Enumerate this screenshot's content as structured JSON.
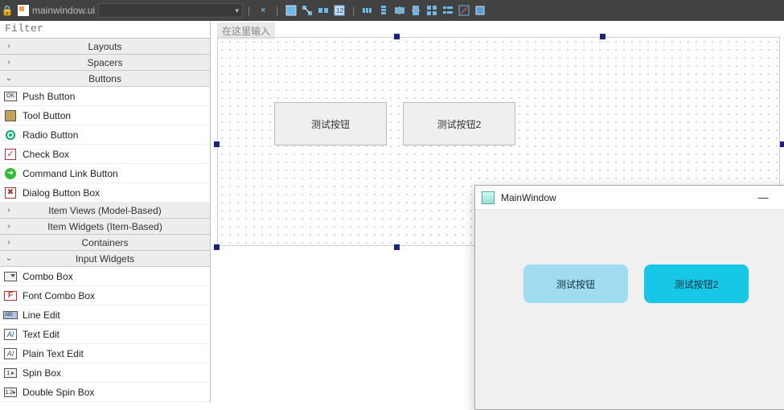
{
  "toolbar": {
    "filename": "mainwindow.ui",
    "close_glyph": "×",
    "icons": [
      "edit-widgets",
      "edit-signals",
      "edit-buddies",
      "edit-tabs",
      "lay-h",
      "lay-v",
      "lay-hs",
      "lay-vs",
      "lay-grid",
      "lay-form",
      "break-layout",
      "adjust-size"
    ]
  },
  "filter_placeholder": "Filter",
  "categories": {
    "layouts": {
      "label": "Layouts",
      "open": false,
      "arrow": "›"
    },
    "spacers": {
      "label": "Spacers",
      "open": false,
      "arrow": "›"
    },
    "buttons": {
      "label": "Buttons",
      "open": true,
      "arrow": "⌄"
    },
    "itemviews": {
      "label": "Item Views (Model-Based)",
      "open": false,
      "arrow": "›"
    },
    "itemwidgets": {
      "label": "Item Widgets (Item-Based)",
      "open": false,
      "arrow": "›"
    },
    "containers": {
      "label": "Containers",
      "open": false,
      "arrow": "›"
    },
    "inputwidgets": {
      "label": "Input Widgets",
      "open": true,
      "arrow": "⌄"
    }
  },
  "buttons_items": [
    {
      "label": "Push Button",
      "icon": "i-ok",
      "glyph": "OK"
    },
    {
      "label": "Tool Button",
      "icon": "i-tool",
      "glyph": ""
    },
    {
      "label": "Radio Button",
      "icon": "i-radio",
      "glyph": ""
    },
    {
      "label": "Check Box",
      "icon": "i-check",
      "glyph": "✓"
    },
    {
      "label": "Command Link Button",
      "icon": "i-cmd",
      "glyph": "➜"
    },
    {
      "label": "Dialog Button Box",
      "icon": "i-dlg",
      "glyph": "✖"
    }
  ],
  "input_items": [
    {
      "label": "Combo Box",
      "icon": "i-combo",
      "glyph": ""
    },
    {
      "label": "Font Combo Box",
      "icon": "i-font",
      "glyph": "F"
    },
    {
      "label": "Line Edit",
      "icon": "i-line",
      "glyph": "ABI"
    },
    {
      "label": "Text Edit",
      "icon": "i-text",
      "glyph": "AI"
    },
    {
      "label": "Plain Text Edit",
      "icon": "i-text plain",
      "glyph": "AI"
    },
    {
      "label": "Spin Box",
      "icon": "i-spin",
      "glyph": "1 ▸"
    },
    {
      "label": "Double Spin Box",
      "icon": "i-spin",
      "glyph": "1.2▸"
    }
  ],
  "designer": {
    "form_hint": "在这里输入",
    "btn1": "测试按钮",
    "btn2": "测试按钮2"
  },
  "runwin": {
    "title": "MainWindow",
    "minimize": "—",
    "maximize": "☐",
    "close": "✕",
    "btn1": "测试按钮",
    "btn2": "测试按钮2"
  }
}
